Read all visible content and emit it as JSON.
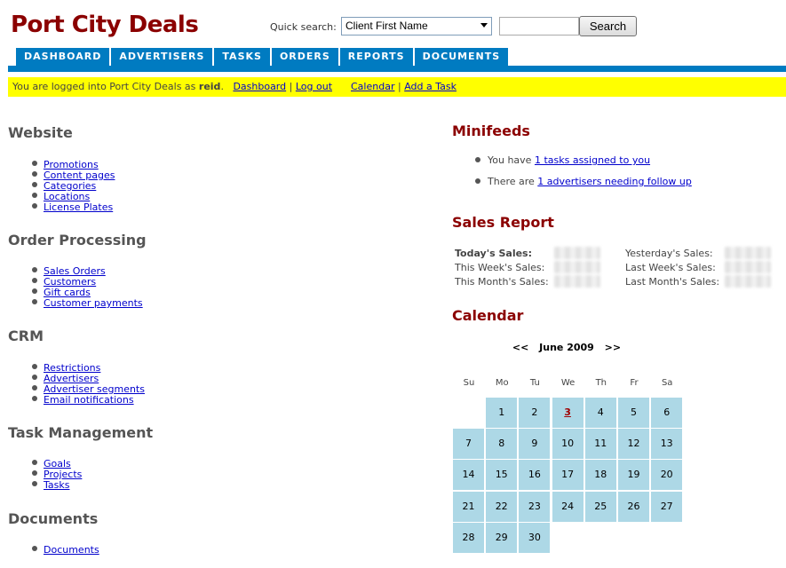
{
  "header": {
    "site_title": "Port City Deals",
    "quick_search_label": "Quick search:",
    "search_select_value": "Client First Name",
    "search_input_value": "",
    "search_button": "Search"
  },
  "nav": {
    "tabs": [
      "DASHBOARD",
      "ADVERTISERS",
      "TASKS",
      "ORDERS",
      "REPORTS",
      "DOCUMENTS"
    ],
    "accent_color": "#007bc1"
  },
  "login_bar": {
    "prefix": "You are logged into Port City Deals as ",
    "username": "reid",
    "suffix": ".",
    "link_dashboard": "Dashboard",
    "sep": "|",
    "link_logout": "Log out",
    "link_calendar": "Calendar",
    "link_add_task": "Add a Task",
    "bg_color": "#ffff00"
  },
  "left": {
    "website": {
      "heading": "Website",
      "items": [
        "Promotions",
        "Content pages",
        "Categories",
        "Locations",
        "License Plates"
      ]
    },
    "order_processing": {
      "heading": "Order Processing",
      "items": [
        "Sales Orders",
        "Customers",
        "Gift cards",
        "Customer payments"
      ]
    },
    "crm": {
      "heading": "CRM",
      "items": [
        "Restrictions",
        "Advertisers",
        "Advertiser segments",
        "Email notifications"
      ]
    },
    "task_management": {
      "heading": "Task Management",
      "items": [
        "Goals",
        "Projects",
        "Tasks"
      ]
    },
    "documents": {
      "heading": "Documents",
      "items": [
        "Documents"
      ]
    }
  },
  "minifeeds": {
    "heading": "Minifeeds",
    "item1_prefix": "You have ",
    "item1_link": "1 tasks assigned to you",
    "item2_prefix": "There are ",
    "item2_link": "1 advertisers needing follow up"
  },
  "sales_report": {
    "heading": "Sales Report",
    "todays": "Today's Sales:",
    "this_week": "This Week's Sales:",
    "this_month": "This Month's Sales:",
    "yesterday": "Yesterday's Sales:",
    "last_week": "Last Week's Sales:",
    "last_month": "Last Month's Sales:"
  },
  "calendar": {
    "heading": "Calendar",
    "prev": "<<",
    "month": "June 2009",
    "next": ">>",
    "weekdays": [
      "Su",
      "Mo",
      "Tu",
      "We",
      "Th",
      "Fr",
      "Sa"
    ],
    "first_weekday_index": 1,
    "days_in_month": 30,
    "today": 3,
    "cell_color": "#add8e6"
  },
  "colors": {
    "title": "#8b0000",
    "link": "#0000cc"
  }
}
